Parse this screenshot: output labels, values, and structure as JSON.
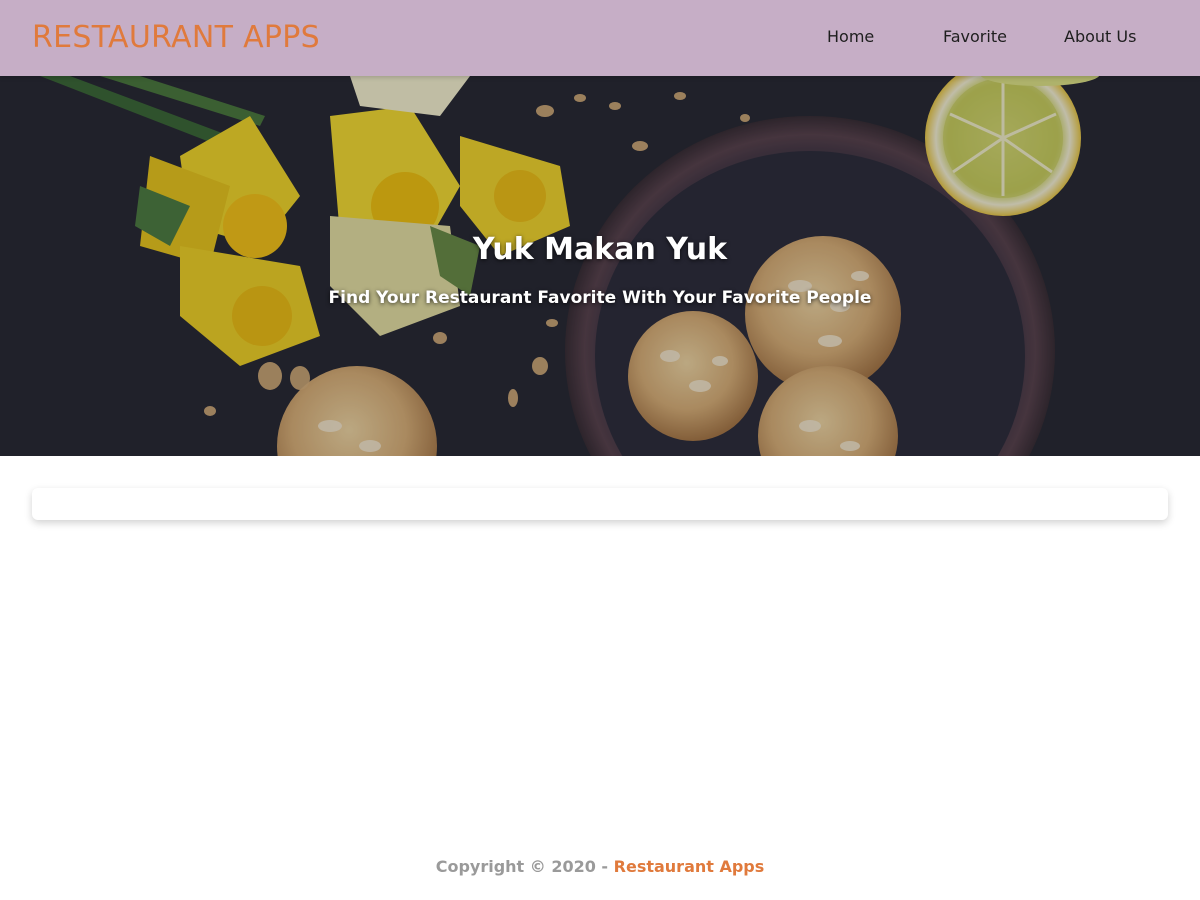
{
  "header": {
    "brand": "RESTAURANT APPS",
    "nav": [
      "Home",
      "Favorite",
      "About Us"
    ]
  },
  "hero": {
    "title": "Yuk Makan Yuk",
    "subtitle": "Find Your Restaurant Favorite With Your Favorite People"
  },
  "footer": {
    "copyright": "Copyright © 2020 - ",
    "brand_link": "Restaurant Apps"
  },
  "colors": {
    "header_bg": "#c6aec6",
    "brand": "#e07a3c",
    "footer_text": "#9a9a9a"
  }
}
